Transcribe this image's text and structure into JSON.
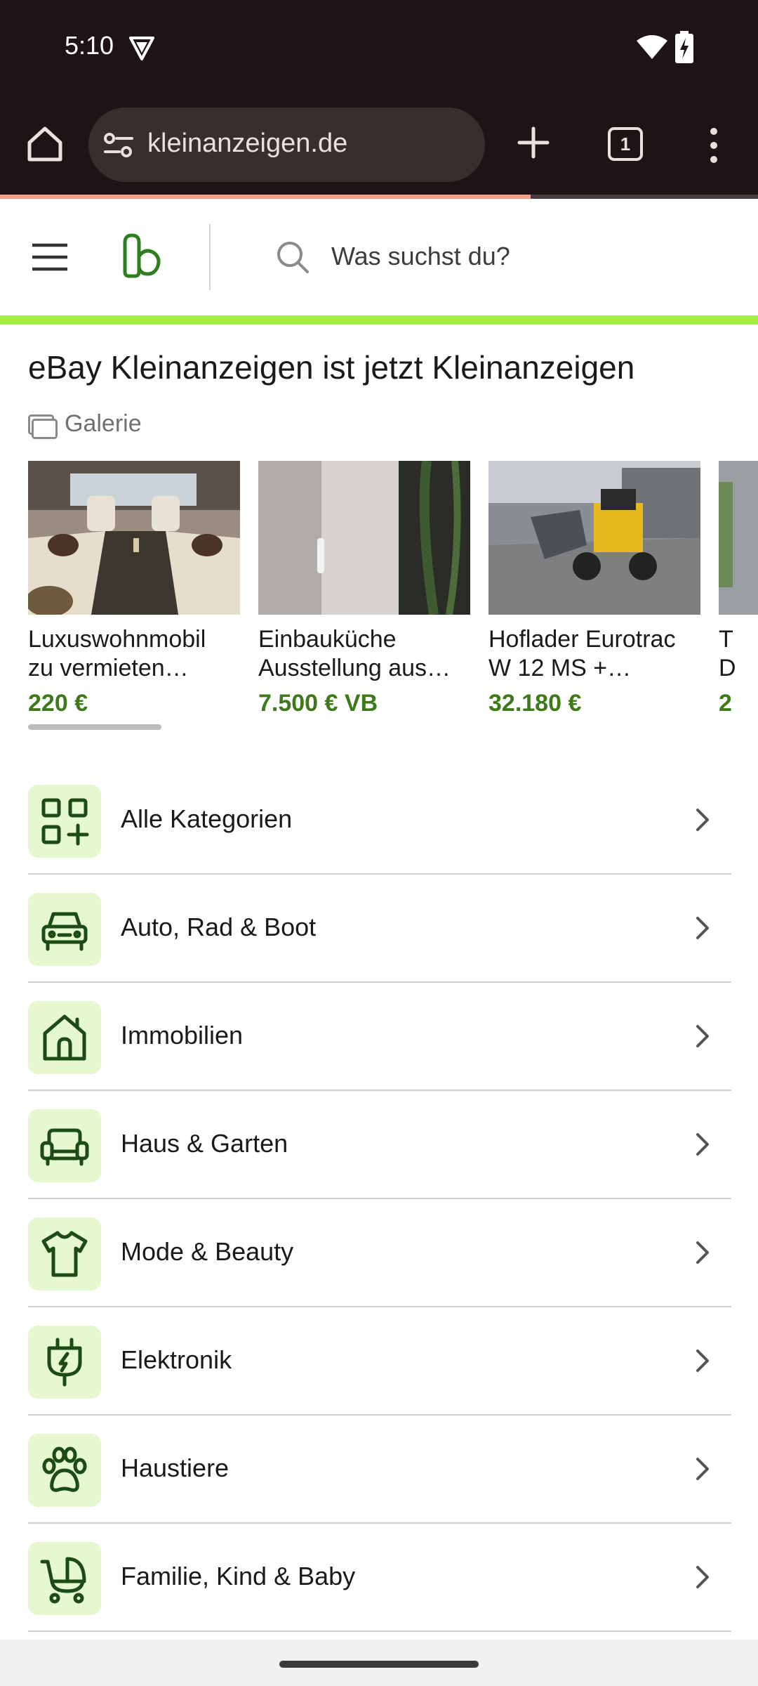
{
  "status_bar": {
    "time": "5:10"
  },
  "browser": {
    "url": "kleinanzeigen.de",
    "tab_count": "1",
    "load_progress": 0.7
  },
  "header": {
    "search_placeholder": "Was suchst du?"
  },
  "page": {
    "title": "eBay Kleinanzeigen ist jetzt Kleinanzeigen",
    "gallery_label": "Galerie"
  },
  "gallery": [
    {
      "title_line1": "Luxuswohnmobil",
      "title_line2": "zu vermieten…",
      "price": "220 €"
    },
    {
      "title_line1": "Einbauküche",
      "title_line2": "Ausstellung aus…",
      "price": "7.500 € VB"
    },
    {
      "title_line1": "Hoflader Eurotrac",
      "title_line2": "W 12 MS +…",
      "price": "32.180 €"
    },
    {
      "title_line1": "T",
      "title_line2": "D",
      "price": "2"
    }
  ],
  "categories": [
    {
      "label": "Alle Kategorien",
      "icon": "grid-plus-icon"
    },
    {
      "label": "Auto, Rad & Boot",
      "icon": "car-icon"
    },
    {
      "label": "Immobilien",
      "icon": "house-icon"
    },
    {
      "label": "Haus & Garten",
      "icon": "sofa-icon"
    },
    {
      "label": "Mode & Beauty",
      "icon": "tshirt-icon"
    },
    {
      "label": "Elektronik",
      "icon": "plug-icon"
    },
    {
      "label": "Haustiere",
      "icon": "paw-icon"
    },
    {
      "label": "Familie, Kind & Baby",
      "icon": "stroller-icon"
    }
  ],
  "colors": {
    "accent_green": "#a4ee48",
    "price_green": "#3f7a1a",
    "icon_green": "#1d4b14",
    "icon_bg": "#e6f8d0",
    "browser_chrome": "#1f1415"
  }
}
